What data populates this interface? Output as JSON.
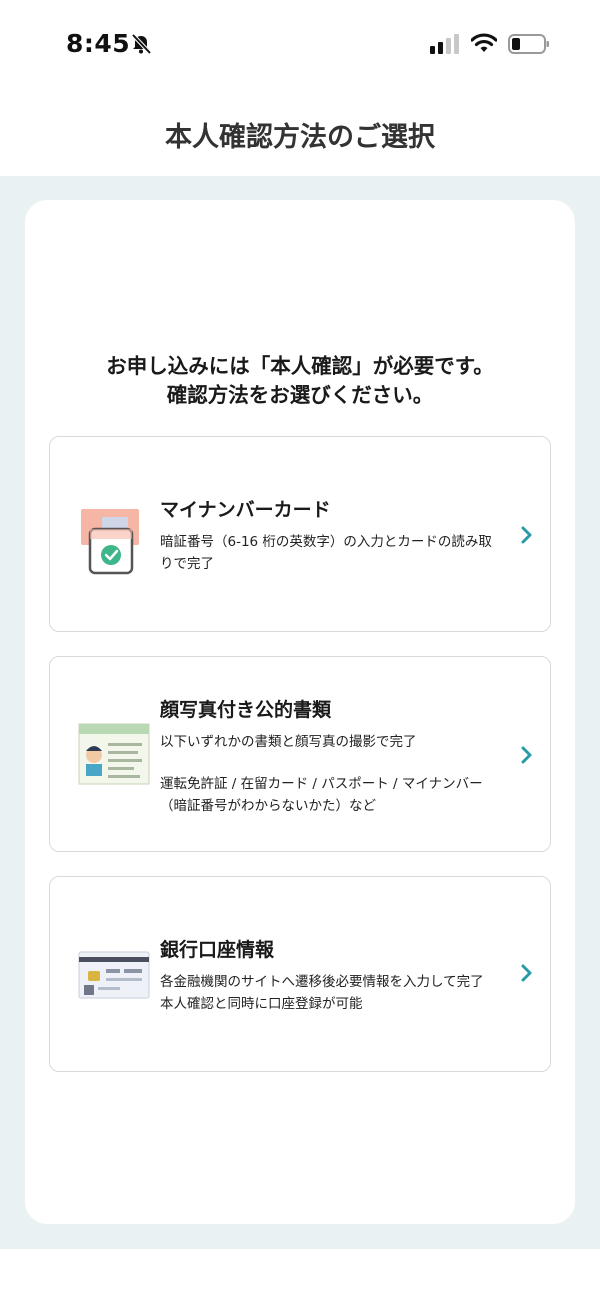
{
  "status_bar": {
    "time": "8:45"
  },
  "header": {
    "title": "本人確認方法のご選択"
  },
  "intro": {
    "line1": "お申し込みには「本人確認」が必要です。",
    "line2": "確認方法をお選びください。"
  },
  "options": [
    {
      "title": "マイナンバーカード",
      "desc_line1": "暗証番号（6-16 桁の英数字）の入力とカードの読み取",
      "desc_line2": "りで完了",
      "icon": "my-number-card-illustration"
    },
    {
      "title": "顔写真付き公的書類",
      "desc_line1": "以下いずれかの書類と顔写真の撮影で完了",
      "desc_line2": "運転免許証 / 在留カード / パスポート / マイナンバー",
      "desc_line3": "（暗証番号がわからないかた）など",
      "icon": "photo-id-document-illustration"
    },
    {
      "title": "銀行口座情報",
      "desc_line1": "各金融機関のサイトへ遷移後必要情報を入力して完了",
      "desc_line2": "本人確認と同時に口座登録が可能",
      "icon": "bank-card-illustration"
    }
  ],
  "colors": {
    "accent": "#2a9aa8",
    "background": "#eaf1f3",
    "card_border": "#d6dbdd"
  }
}
